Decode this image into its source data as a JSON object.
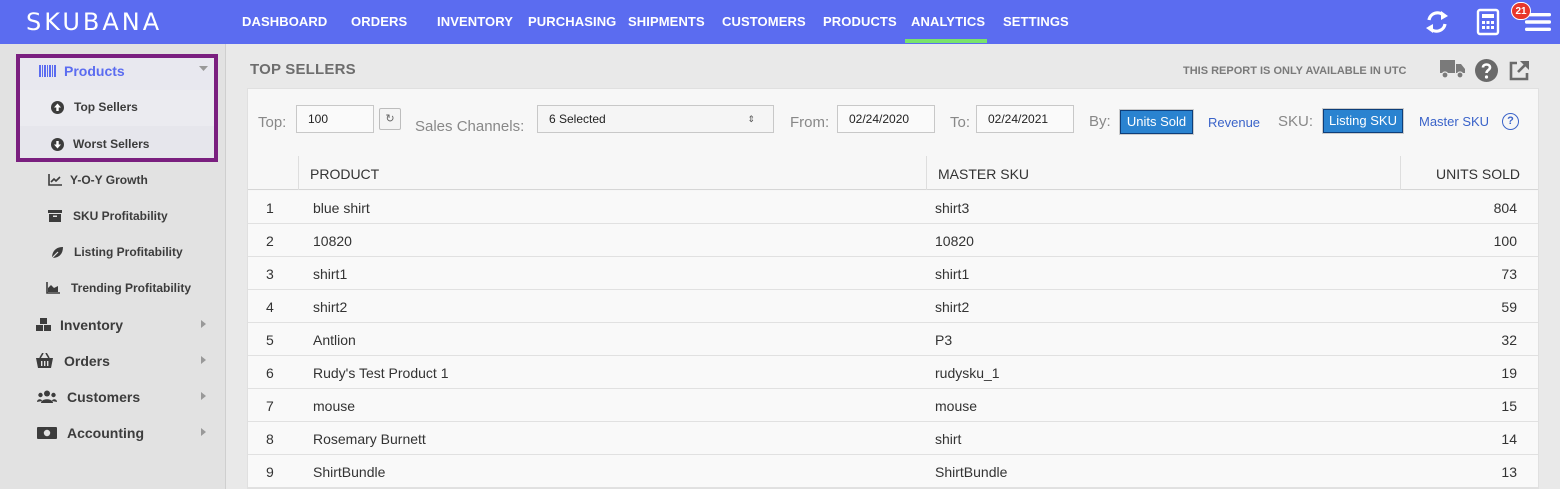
{
  "app": {
    "logo": "SKUBANA",
    "notification_count": "21"
  },
  "nav": [
    {
      "label": "DASHBOARD",
      "active": false
    },
    {
      "label": "ORDERS",
      "active": false
    },
    {
      "label": "INVENTORY",
      "active": false
    },
    {
      "label": "PURCHASING",
      "active": false
    },
    {
      "label": "SHIPMENTS",
      "active": false
    },
    {
      "label": "CUSTOMERS",
      "active": false
    },
    {
      "label": "PRODUCTS",
      "active": false
    },
    {
      "label": "ANALYTICS",
      "active": true
    },
    {
      "label": "SETTINGS",
      "active": false
    }
  ],
  "top_icons": [
    "refresh-icon",
    "calculator-icon",
    "menu-icon"
  ],
  "sidebar": {
    "products": "Products",
    "sub_items": [
      {
        "label": "Top Sellers",
        "icon": "arrow-up-circle-icon"
      },
      {
        "label": "Worst Sellers",
        "icon": "arrow-down-circle-icon"
      },
      {
        "label": "Y-O-Y Growth",
        "icon": "line-chart-icon"
      },
      {
        "label": "SKU Profitability",
        "icon": "archive-icon"
      },
      {
        "label": "Listing Profitability",
        "icon": "leaf-icon"
      },
      {
        "label": "Trending Profitability",
        "icon": "area-chart-icon"
      }
    ],
    "sections": [
      {
        "label": "Inventory",
        "icon": "cubes-icon"
      },
      {
        "label": "Orders",
        "icon": "basket-icon"
      },
      {
        "label": "Customers",
        "icon": "users-icon"
      },
      {
        "label": "Accounting",
        "icon": "money-icon"
      }
    ]
  },
  "page": {
    "title": "TOP SELLERS",
    "utc_note": "THIS REPORT IS ONLY AVAILABLE IN UTC"
  },
  "filters": {
    "top_label": "Top:",
    "top_value": "100",
    "channels_label": "Sales Channels:",
    "channels_value": "6 Selected",
    "from_label": "From:",
    "from_value": "02/24/2020",
    "to_label": "To:",
    "to_value": "02/24/2021",
    "by_label": "By:",
    "by_active": "Units Sold",
    "by_other": "Revenue",
    "sku_label": "SKU:",
    "sku_active": "Listing SKU",
    "sku_other": "Master SKU",
    "help": "?"
  },
  "table": {
    "columns": [
      "PRODUCT",
      "MASTER SKU",
      "UNITS SOLD"
    ],
    "rows": [
      {
        "rank": "1",
        "product": "blue shirt",
        "sku": "shirt3",
        "units": "804"
      },
      {
        "rank": "2",
        "product": "10820",
        "sku": "10820",
        "units": "100"
      },
      {
        "rank": "3",
        "product": "shirt1",
        "sku": "shirt1",
        "units": "73"
      },
      {
        "rank": "4",
        "product": "shirt2",
        "sku": "shirt2",
        "units": "59"
      },
      {
        "rank": "5",
        "product": "Antlion",
        "sku": "P3",
        "units": "32"
      },
      {
        "rank": "6",
        "product": "Rudy's Test Product 1",
        "sku": "rudysku_1",
        "units": "19"
      },
      {
        "rank": "7",
        "product": "mouse",
        "sku": "mouse",
        "units": "15"
      },
      {
        "rank": "8",
        "product": "Rosemary Burnett",
        "sku": "shirt",
        "units": "14"
      },
      {
        "rank": "9",
        "product": "ShirtBundle",
        "sku": "ShirtBundle",
        "units": "13"
      }
    ]
  },
  "colors": {
    "topbar": "#5b6cf0",
    "active_underline": "#79e36b",
    "accent": "#2a83d0",
    "highlight_box": "#7a1f7f"
  }
}
